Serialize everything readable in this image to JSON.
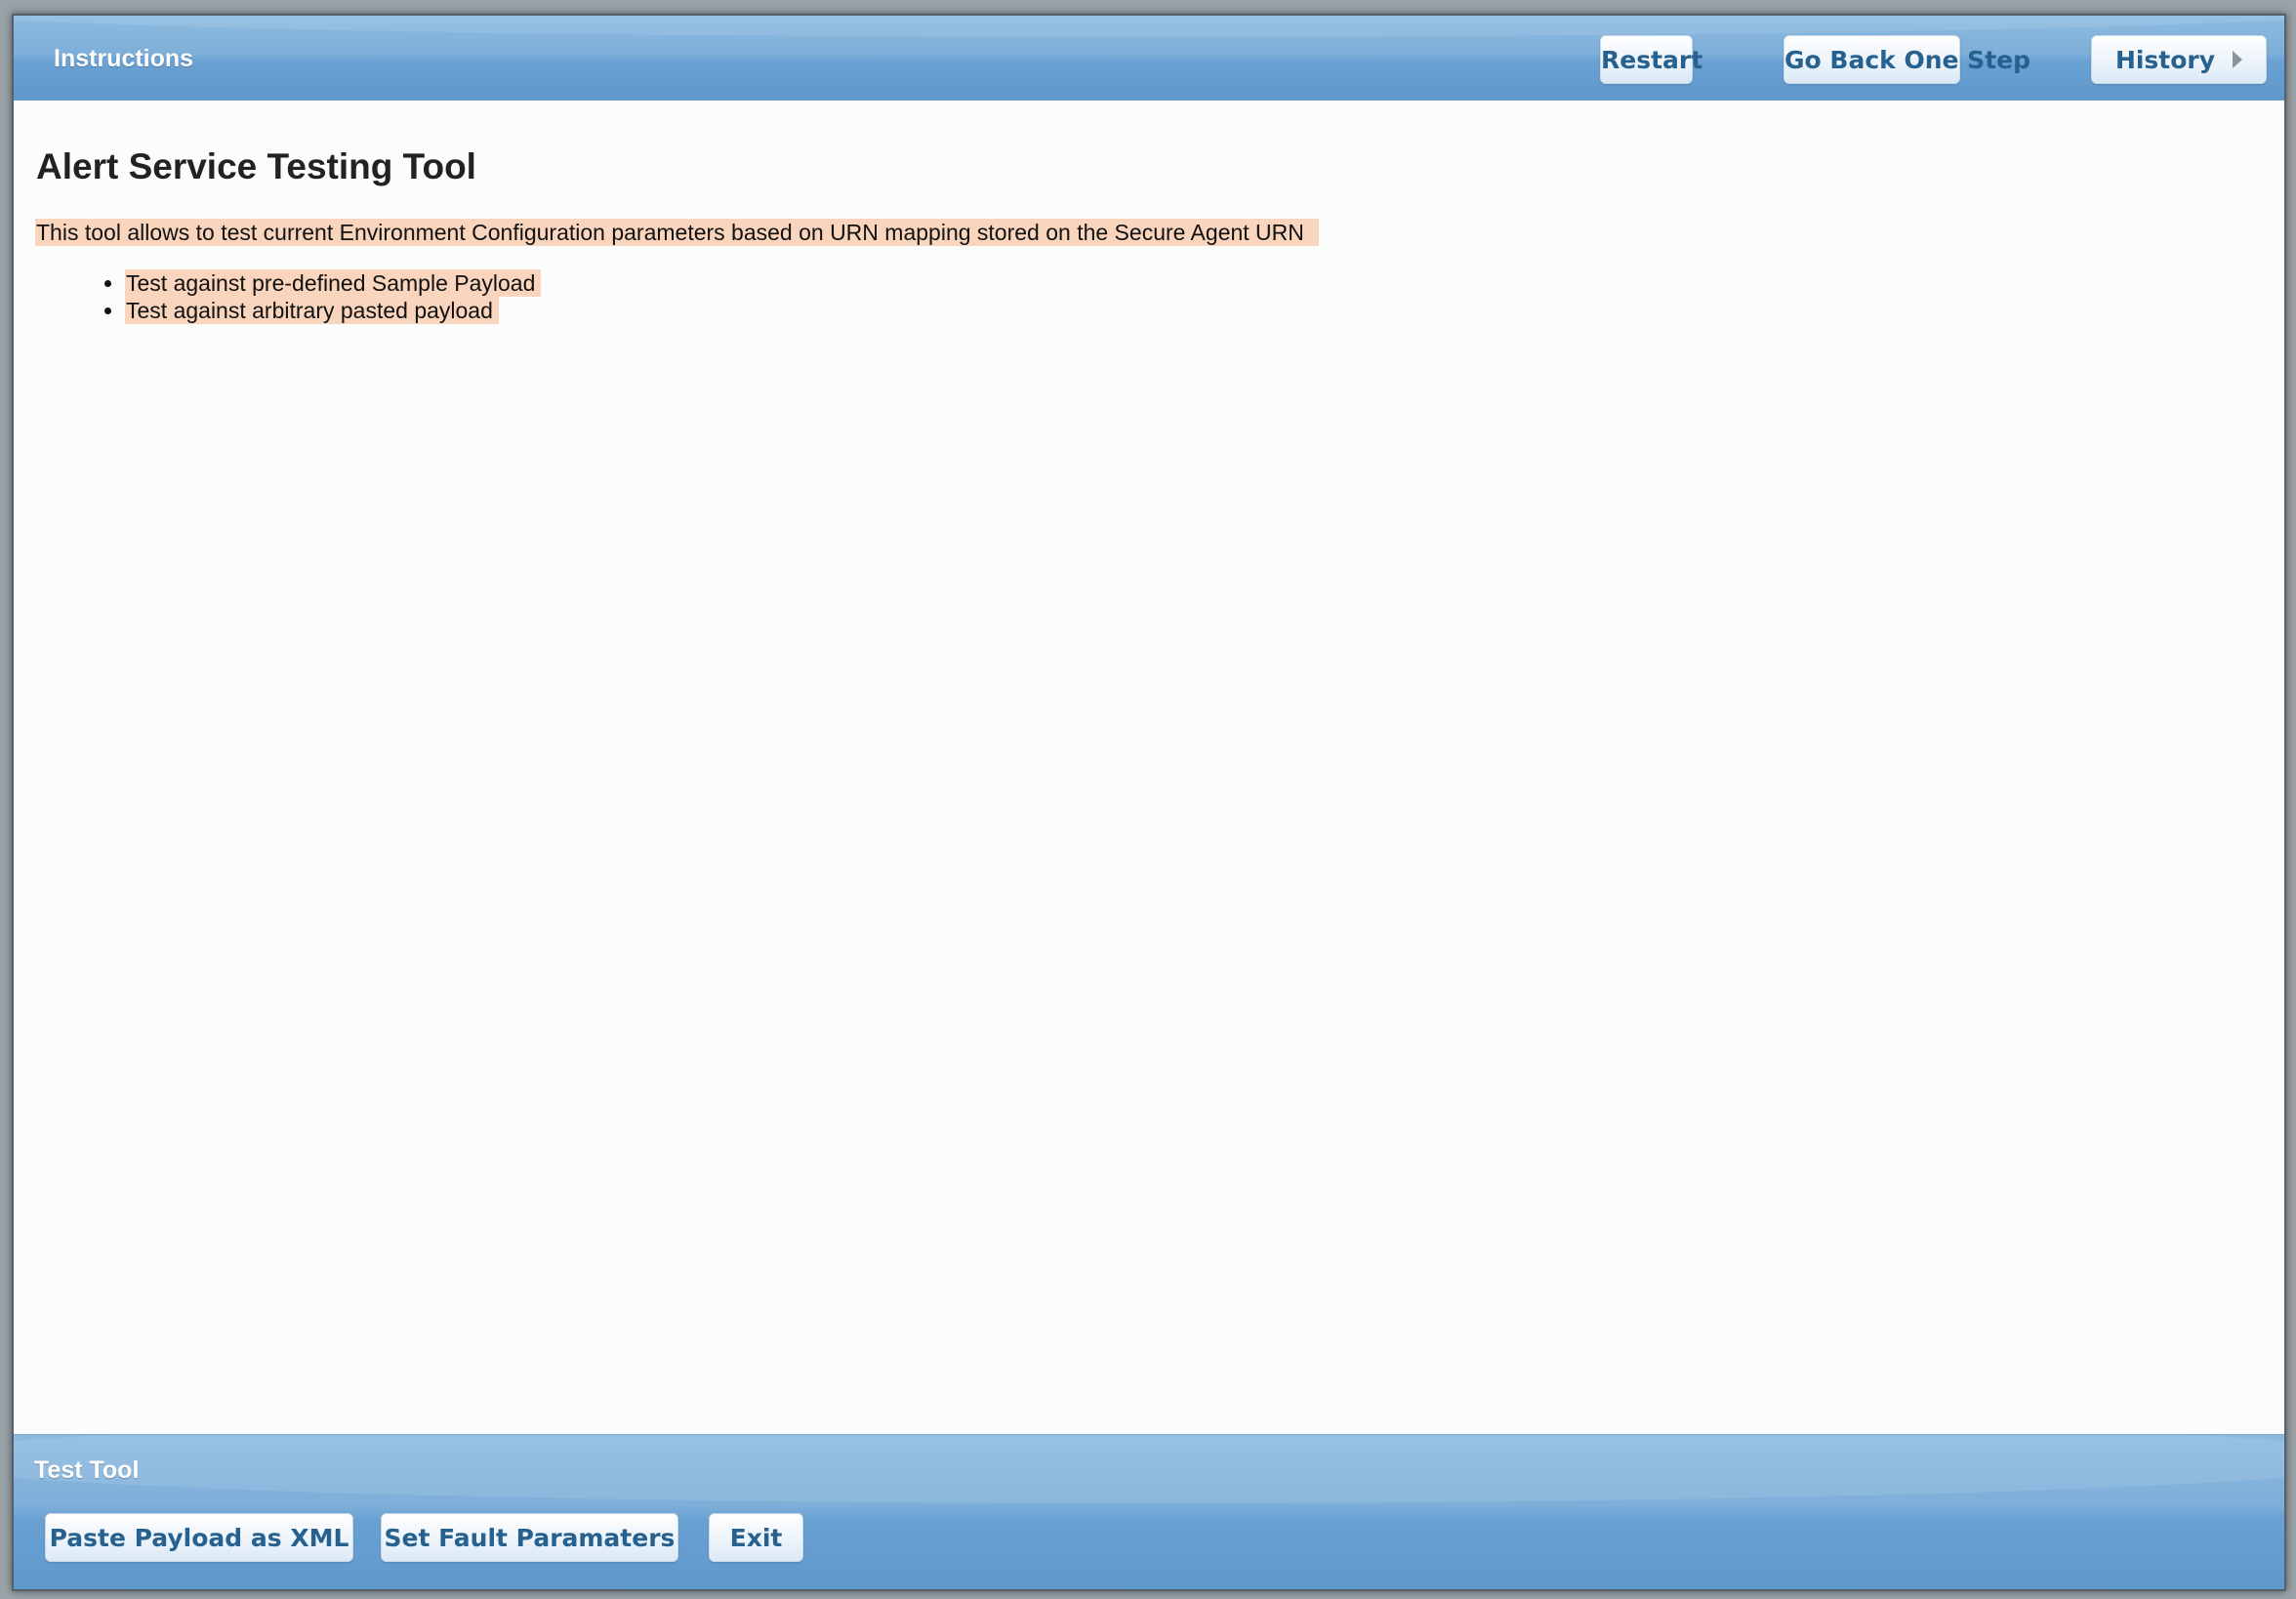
{
  "header": {
    "title": "Instructions",
    "buttons": {
      "restart": "Restart",
      "go_back": "Go Back One Step",
      "history": "History"
    }
  },
  "main": {
    "title": "Alert Service Testing Tool",
    "description": "This tool allows to test current Environment Configuration parameters based on URN mapping stored on the Secure Agent URN",
    "bullets": [
      "Test against pre-defined Sample Payload",
      "Test against arbitrary pasted payload"
    ]
  },
  "footer": {
    "title": "Test Tool",
    "buttons": {
      "paste_payload": "Paste Payload as XML",
      "set_fault": "Set Fault Paramaters",
      "exit": "Exit"
    }
  },
  "colors": {
    "bar_blue": "#6aa1d3",
    "button_text": "#26618f",
    "highlight": "#fad5bd"
  }
}
